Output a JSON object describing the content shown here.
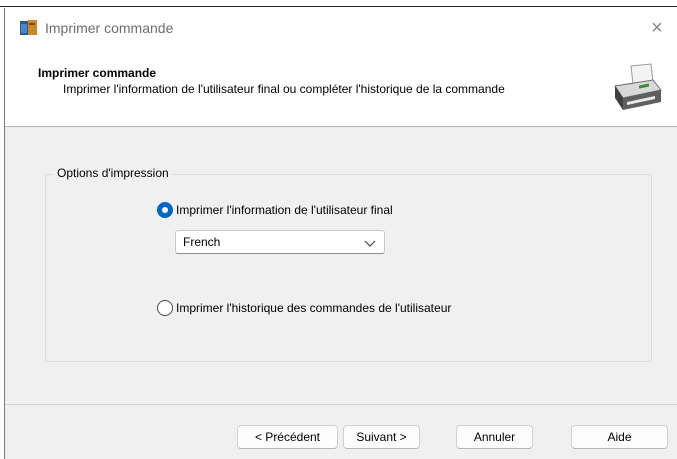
{
  "window": {
    "title": "Imprimer commande",
    "close_glyph": "×"
  },
  "header": {
    "title": "Imprimer commande",
    "subtitle": "Imprimer l'information de l'utilisateur final ou compléter l'historique de la commande",
    "icon": "printer-icon"
  },
  "options": {
    "group_label": "Options d'impression",
    "choices": [
      {
        "label": "Imprimer l'information de l'utilisateur final",
        "selected": true
      },
      {
        "label": "Imprimer l'historique des commandes de l'utilisateur",
        "selected": false
      }
    ],
    "language_select": {
      "value": "French"
    }
  },
  "buttons": {
    "previous": "< Précédent",
    "next": "Suivant >",
    "cancel": "Annuler",
    "help": "Aide"
  },
  "colors": {
    "accent": "#0067c0",
    "dialog_bg": "#f0f0f0"
  }
}
